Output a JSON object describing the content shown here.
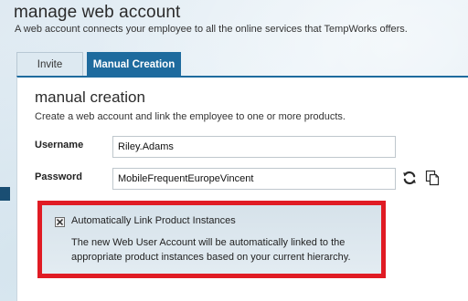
{
  "header": {
    "title": "manage web account",
    "subtitle": "A web account connects your employee to all the online services that TempWorks offers."
  },
  "tabs": [
    {
      "label": "Invite",
      "active": false
    },
    {
      "label": "Manual Creation",
      "active": true
    }
  ],
  "manual_creation": {
    "title": "manual creation",
    "description": "Create a web account and link the employee to one or more products.",
    "username": {
      "label": "Username",
      "value": "Riley.Adams"
    },
    "password": {
      "label": "Password",
      "value": "MobileFrequentEuropeVincent",
      "refresh_icon": "refresh-icon",
      "copy_icon": "copy-icon"
    },
    "auto_link": {
      "checkbox_label": "Automatically Link Product Instances",
      "checked": true,
      "description": "The new Web User Account will be automatically linked to the appropriate product instances based on your current hierarchy."
    }
  },
  "colors": {
    "accent": "#1e6b9e",
    "highlight_border": "#e01b24",
    "background": "#e3eef5"
  }
}
